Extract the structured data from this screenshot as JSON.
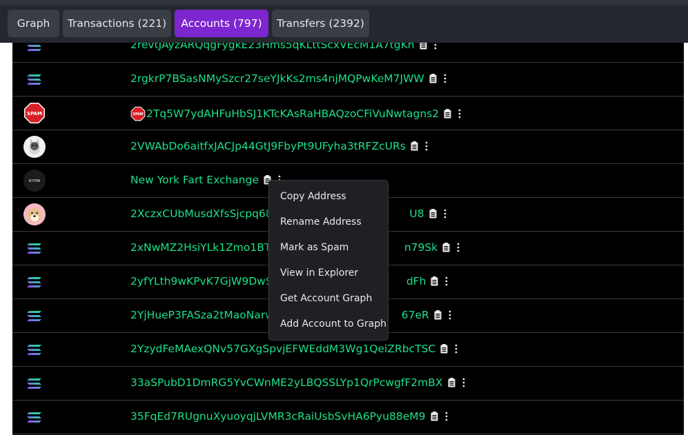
{
  "tabs": [
    {
      "label": "Graph",
      "active": false
    },
    {
      "label": "Transactions (221)",
      "active": false
    },
    {
      "label": "Accounts (797)",
      "active": true
    },
    {
      "label": "Transfers (2392)",
      "active": false
    }
  ],
  "accounts": [
    {
      "icon": "solana-logo-icon",
      "address": "2revtJAyzARQqgFygkE23Hms5qKLttScxVEcM1A7tgKh"
    },
    {
      "icon": "solana-logo-icon",
      "address": "2rgkrP7BSasNMySzcr27seYJkKs2ms4njMQPwKeM7JWW"
    },
    {
      "icon": "spam-stop-icon",
      "icon_label": "SPAM",
      "address": "2Tq5W7ydAHFuHbSJ1KTcKAsRaHBAQzoCFiVuNwtagns2",
      "inline_icon": "spam-stop-icon"
    },
    {
      "icon": "cat-avatar-icon",
      "address": "2VWAbDo6aitfxJACJp44GtJ9FbyPt9UFyha3tRFZcURs"
    },
    {
      "icon": "nyfe-logo-icon",
      "icon_label": "NYFE",
      "address": "New York Fart Exchange"
    },
    {
      "icon": "dog-avatar-icon",
      "address": "2XczxCUbMusdXfsSjcpq68FC",
      "address_tail": "U8"
    },
    {
      "icon": "solana-logo-icon",
      "address": "2xNwMZ2HsiYLk1Zmo1BT9L",
      "address_tail": "n79Sk"
    },
    {
      "icon": "solana-logo-icon",
      "address": "2yfYLth9wKPvK7GjW9DwScV",
      "address_tail": "dFh"
    },
    {
      "icon": "solana-logo-icon",
      "address": "2YjHueP3FASza2tMaoNarwS",
      "address_tail": "67eR"
    },
    {
      "icon": "solana-logo-icon",
      "address": "2YzydFeMAexQNv57GXgSpvjEFWEddM3Wg1QeiZRbcTSC"
    },
    {
      "icon": "solana-logo-icon",
      "address": "33aSPubD1DmRG5YvCWnME2yLBQSSLYp1QrPcwgfF2mBX"
    },
    {
      "icon": "solana-logo-icon",
      "address": "35FqEd7RUgnuXyuoyqjLVMR3cRaiUsbSvHA6Pyu88eM9"
    }
  ],
  "context_menu": {
    "items": [
      "Copy Address",
      "Rename Address",
      "Mark as Spam",
      "View in Explorer",
      "Get Account Graph",
      "Add Account to Graph"
    ]
  },
  "colors": {
    "accent": "#7d25cf",
    "address": "#1de08a",
    "tab_bg": "#393d45",
    "menu_bg": "#1f2024"
  }
}
